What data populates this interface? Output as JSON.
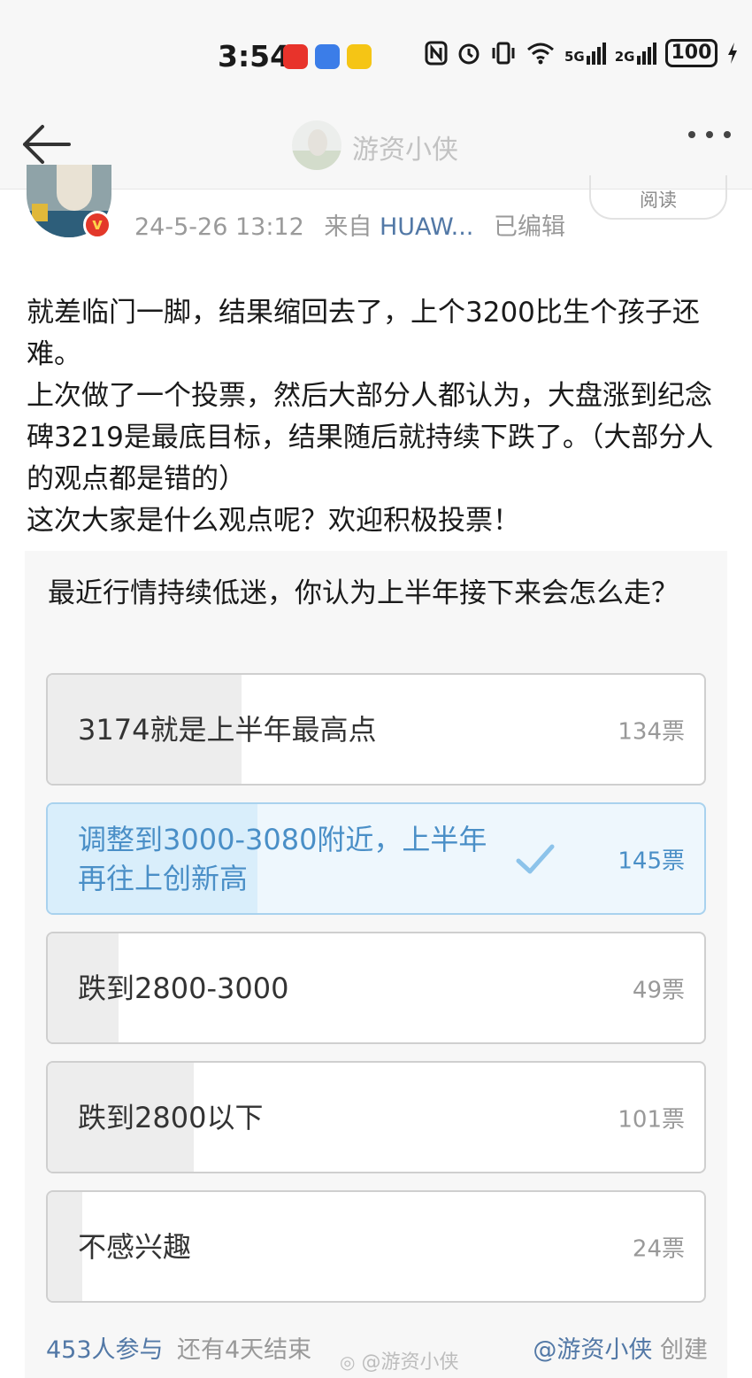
{
  "status_bar": {
    "time": "3:54",
    "icons": [
      "app-icon-red",
      "app-icon-blue",
      "app-icon-yellow",
      "nfc-icon",
      "alarm-icon",
      "vibrate-icon",
      "wifi-icon",
      "signal-5g-icon",
      "signal-2g-icon"
    ],
    "signal_1": "5G",
    "signal_2": "2G",
    "battery": "100"
  },
  "header": {
    "title": "游资小侠",
    "icons": [
      "back-arrow-icon",
      "more-icon"
    ]
  },
  "post": {
    "meta_time": "24-5-26 13:12",
    "meta_from": "来自",
    "meta_source": "HUAW...",
    "meta_edited": "已编辑",
    "read_label": "阅读",
    "text_lines": [
      "就差临门一脚，结果缩回去了，上个3200比生个孩子还难。",
      "上次做了一个投票，然后大部分人都认为，大盘涨到纪念碑3219是最底目标，结果随后就持续下跌了。（大部分人的观点都是错的）",
      "这次大家是什么观点呢？欢迎积极投票！"
    ]
  },
  "poll": {
    "question": "最近行情持续低迷，你认为上半年接下来会怎么走？",
    "options": [
      {
        "label": "3174就是上半年最高点",
        "votes": "134票",
        "count": 134
      },
      {
        "label": "调整到3000-3080附近，上半年再往上创新高",
        "votes": "145票",
        "count": 145,
        "selected": true
      },
      {
        "label": "跌到2800-3000",
        "votes": "49票",
        "count": 49
      },
      {
        "label": "跌到2800以下",
        "votes": "101票",
        "count": 101
      },
      {
        "label": "不感兴趣",
        "votes": "24票",
        "count": 24
      }
    ],
    "participants": "453人参与",
    "remaining": "还有4天结束",
    "creator_handle": "@游资小侠",
    "creator_suffix": "创建",
    "watermark": "@游资小侠",
    "colors": {
      "accent": "#5278a6",
      "selected_text": "#4a8fc7",
      "selected_bg": "#eef7fd"
    }
  }
}
